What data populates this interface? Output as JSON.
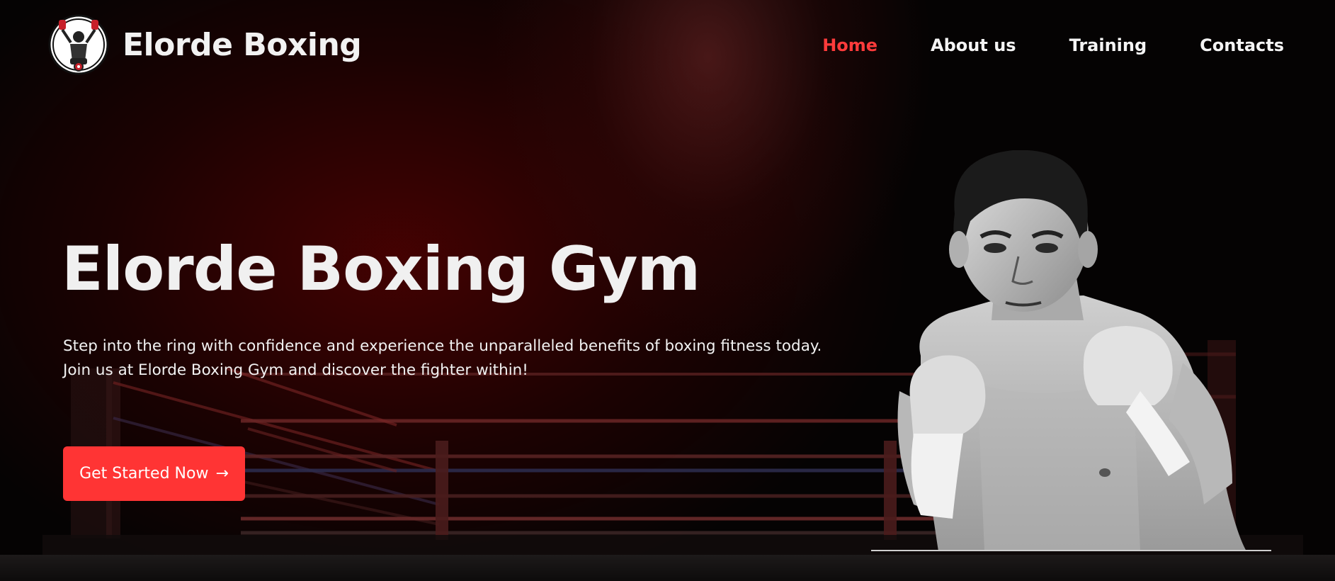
{
  "header": {
    "brand": "Elorde Boxing",
    "logo_icon": "boxer-logo-icon",
    "nav": [
      {
        "label": "Home",
        "active": true
      },
      {
        "label": "About us",
        "active": false
      },
      {
        "label": "Training",
        "active": false
      },
      {
        "label": "Contacts",
        "active": false
      }
    ]
  },
  "hero": {
    "title": "Elorde Boxing Gym",
    "line1": "Step into the ring with confidence and experience the unparalleled benefits of boxing fitness today.",
    "line2": "Join us at Elorde Boxing Gym and discover the fighter within!",
    "cta_label": "Get Started Now",
    "cta_icon": "arrow-right-icon"
  },
  "colors": {
    "accent": "#ff3434",
    "nav_active": "#ff3b3b",
    "text": "#f2f2f2",
    "background": "#050303"
  }
}
